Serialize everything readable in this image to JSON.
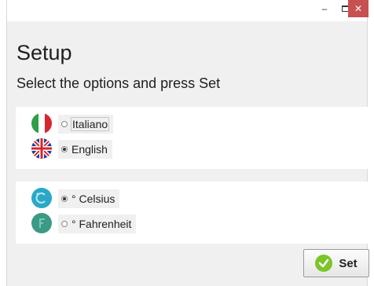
{
  "window": {
    "minimize_glyph": "–",
    "close_glyph": "✕"
  },
  "header": {
    "title": "Setup",
    "subtitle": "Select the options and press Set"
  },
  "language": {
    "options": [
      {
        "label": "Italiano",
        "selected": false,
        "icon": "italy-flag-icon"
      },
      {
        "label": "English",
        "selected": true,
        "icon": "uk-flag-icon"
      }
    ]
  },
  "temperature": {
    "options": [
      {
        "label": "° Celsius",
        "selected": true,
        "icon": "celsius-icon"
      },
      {
        "label": "° Fahrenheit",
        "selected": false,
        "icon": "fahrenheit-icon"
      }
    ]
  },
  "actions": {
    "set_label": "Set"
  },
  "colors": {
    "close_button": "#c75050",
    "check_green": "#7cc42a",
    "celsius_teal": "#29a8c8",
    "fahrenheit_teal": "#3a9a86"
  }
}
